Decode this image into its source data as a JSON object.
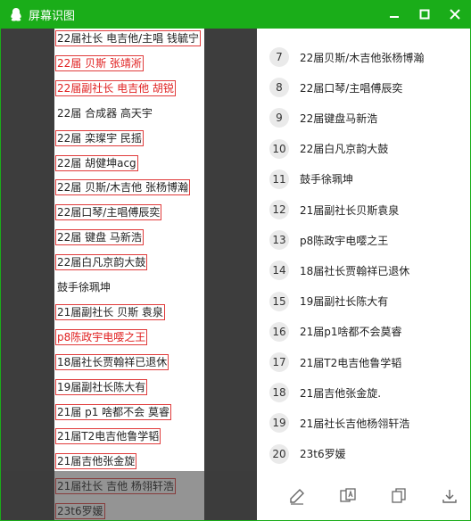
{
  "window": {
    "title": "屏幕识图",
    "icons": {
      "app": "qq-penguin-icon",
      "minimize": "minimize-icon",
      "maximize": "maximize-icon",
      "close": "close-icon"
    },
    "colors": {
      "titlebar": "#1aad19",
      "box_border": "#e03b3b",
      "red_text": "#e02020",
      "left_bg": "#3d3d3d"
    }
  },
  "screenshot": {
    "lines": [
      {
        "text": "22届社长 电吉他/主唱 钱毓宁",
        "red": false
      },
      {
        "text": "22届 贝斯 张靖淅",
        "red": true
      },
      {
        "text": "22届副社长 电吉他 胡锐",
        "red": true
      },
      {
        "text": "22届 合成器 高天宇",
        "red": false,
        "noborder": true
      },
      {
        "text": "22届 栾璨宇 民摇",
        "red": false
      },
      {
        "text": "22届 胡健坤acg",
        "red": false
      },
      {
        "text": "22届 贝斯/木吉他 张杨博瀚",
        "red": false
      },
      {
        "text": "22届口琴/主唱傅辰奕",
        "red": false
      },
      {
        "text": "22届 键盘 马新浩",
        "red": false
      },
      {
        "text": "22届白凡京韵大鼓",
        "red": false
      },
      {
        "text": "鼓手徐珮坤",
        "red": false,
        "noborder": true
      },
      {
        "text": "21届副社长 贝斯 袁泉",
        "red": false
      },
      {
        "text": "p8陈政宇电嘤之王",
        "red": true
      },
      {
        "text": "18届社长贾翰祥已退休",
        "red": false
      },
      {
        "text": "19届副社长陈大有",
        "red": false
      },
      {
        "text": "21届 p1 啥都不会 莫睿",
        "red": false
      },
      {
        "text": "21届T2电吉他鲁学韬",
        "red": false
      },
      {
        "text": "21届吉他张金旋",
        "red": false
      },
      {
        "text": "21届社长 吉他 杨翎轩浩",
        "red": false
      },
      {
        "text": "23t6罗媛",
        "red": false
      }
    ]
  },
  "results": {
    "items": [
      {
        "num": "7",
        "text": "22届贝斯/木吉他张杨博瀚"
      },
      {
        "num": "8",
        "text": "22届口琴/主唱傅辰奕"
      },
      {
        "num": "9",
        "text": "22届键盘马新浩"
      },
      {
        "num": "10",
        "text": "22届白凡京韵大鼓"
      },
      {
        "num": "11",
        "text": "鼓手徐珮坤"
      },
      {
        "num": "12",
        "text": "21届副社长贝斯袁泉"
      },
      {
        "num": "13",
        "text": "p8陈政宇电嘤之王"
      },
      {
        "num": "14",
        "text": "18届社长贾翰祥已退休"
      },
      {
        "num": "15",
        "text": "19届副社长陈大有"
      },
      {
        "num": "16",
        "text": "21届p1啥都不会莫睿"
      },
      {
        "num": "17",
        "text": "21届T2电吉他鲁学韬"
      },
      {
        "num": "18",
        "text": "21届吉他张金旋."
      },
      {
        "num": "19",
        "text": "21届社长吉他杨翎轩浩"
      },
      {
        "num": "20",
        "text": "23t6罗媛"
      }
    ]
  },
  "toolbar": {
    "tools": [
      {
        "name": "edit-tool",
        "icon": "pencil-edit-icon"
      },
      {
        "name": "translate-tool",
        "icon": "translate-icon"
      },
      {
        "name": "copy-tool",
        "icon": "copy-icon"
      },
      {
        "name": "download-tool",
        "icon": "download-icon"
      }
    ]
  }
}
